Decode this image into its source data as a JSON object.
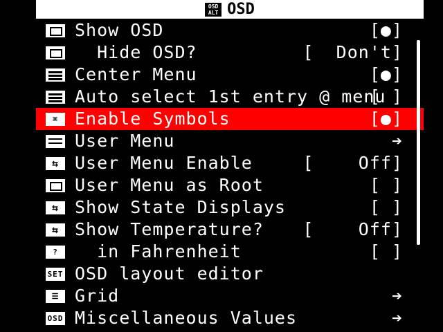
{
  "title": "OSD",
  "title_icon": "OSD\nALT",
  "rows": [
    {
      "icon": "checkbox-icon",
      "icon_style": "box",
      "icon_text": "",
      "label": "Show OSD",
      "value": "[●]",
      "selected": false
    },
    {
      "icon": "checkbox-icon",
      "icon_style": "box",
      "icon_text": "",
      "label": "  Hide OSD?",
      "value": "[  Don't]",
      "selected": false
    },
    {
      "icon": "lines-icon",
      "icon_style": "lines",
      "icon_text": "",
      "label": "Center Menu",
      "value": "[●]",
      "selected": false
    },
    {
      "icon": "lines-icon",
      "icon_style": "lines",
      "icon_text": "",
      "label": "Auto select 1st entry @ menu",
      "value": "[ ]",
      "selected": false
    },
    {
      "icon": "symbols-icon",
      "icon_style": "text",
      "icon_text": "⌘",
      "label": "Enable Symbols",
      "value": "[●]",
      "selected": true
    },
    {
      "icon": "menu-icon",
      "icon_style": "lines-thin",
      "icon_text": "",
      "label": "User Menu",
      "value": "➔",
      "selected": false
    },
    {
      "icon": "swap-icon",
      "icon_style": "arrows",
      "icon_text": "",
      "label": "User Menu Enable",
      "value": "[    Off]",
      "selected": false
    },
    {
      "icon": "checkbox-icon",
      "icon_style": "box",
      "icon_text": "",
      "label": "User Menu as Root",
      "value": "[ ]",
      "selected": false
    },
    {
      "icon": "swap-icon",
      "icon_style": "arrows",
      "icon_text": "",
      "label": "Show State Displays",
      "value": "[ ]",
      "selected": false
    },
    {
      "icon": "swap-icon",
      "icon_style": "arrows",
      "icon_text": "",
      "label": "Show Temperature?",
      "value": "[    Off]",
      "selected": false
    },
    {
      "icon": "question-icon",
      "icon_style": "text",
      "icon_text": "?",
      "label": "  in Fahrenheit",
      "value": "[ ]",
      "selected": false
    },
    {
      "icon": "set-icon",
      "icon_style": "text",
      "icon_text": "SET",
      "label": "OSD layout editor",
      "value": "",
      "selected": false
    },
    {
      "icon": "grid-icon",
      "icon_style": "text",
      "icon_text": "☰",
      "label": "Grid",
      "value": "➔",
      "selected": false
    },
    {
      "icon": "osd-alt-icon",
      "icon_style": "text",
      "icon_text": "OSD",
      "label": "Miscellaneous Values",
      "value": "➔",
      "selected": false
    }
  ],
  "colors": {
    "selected_bg": "#ff0000",
    "bg": "#000000",
    "fg": "#ffffff"
  }
}
